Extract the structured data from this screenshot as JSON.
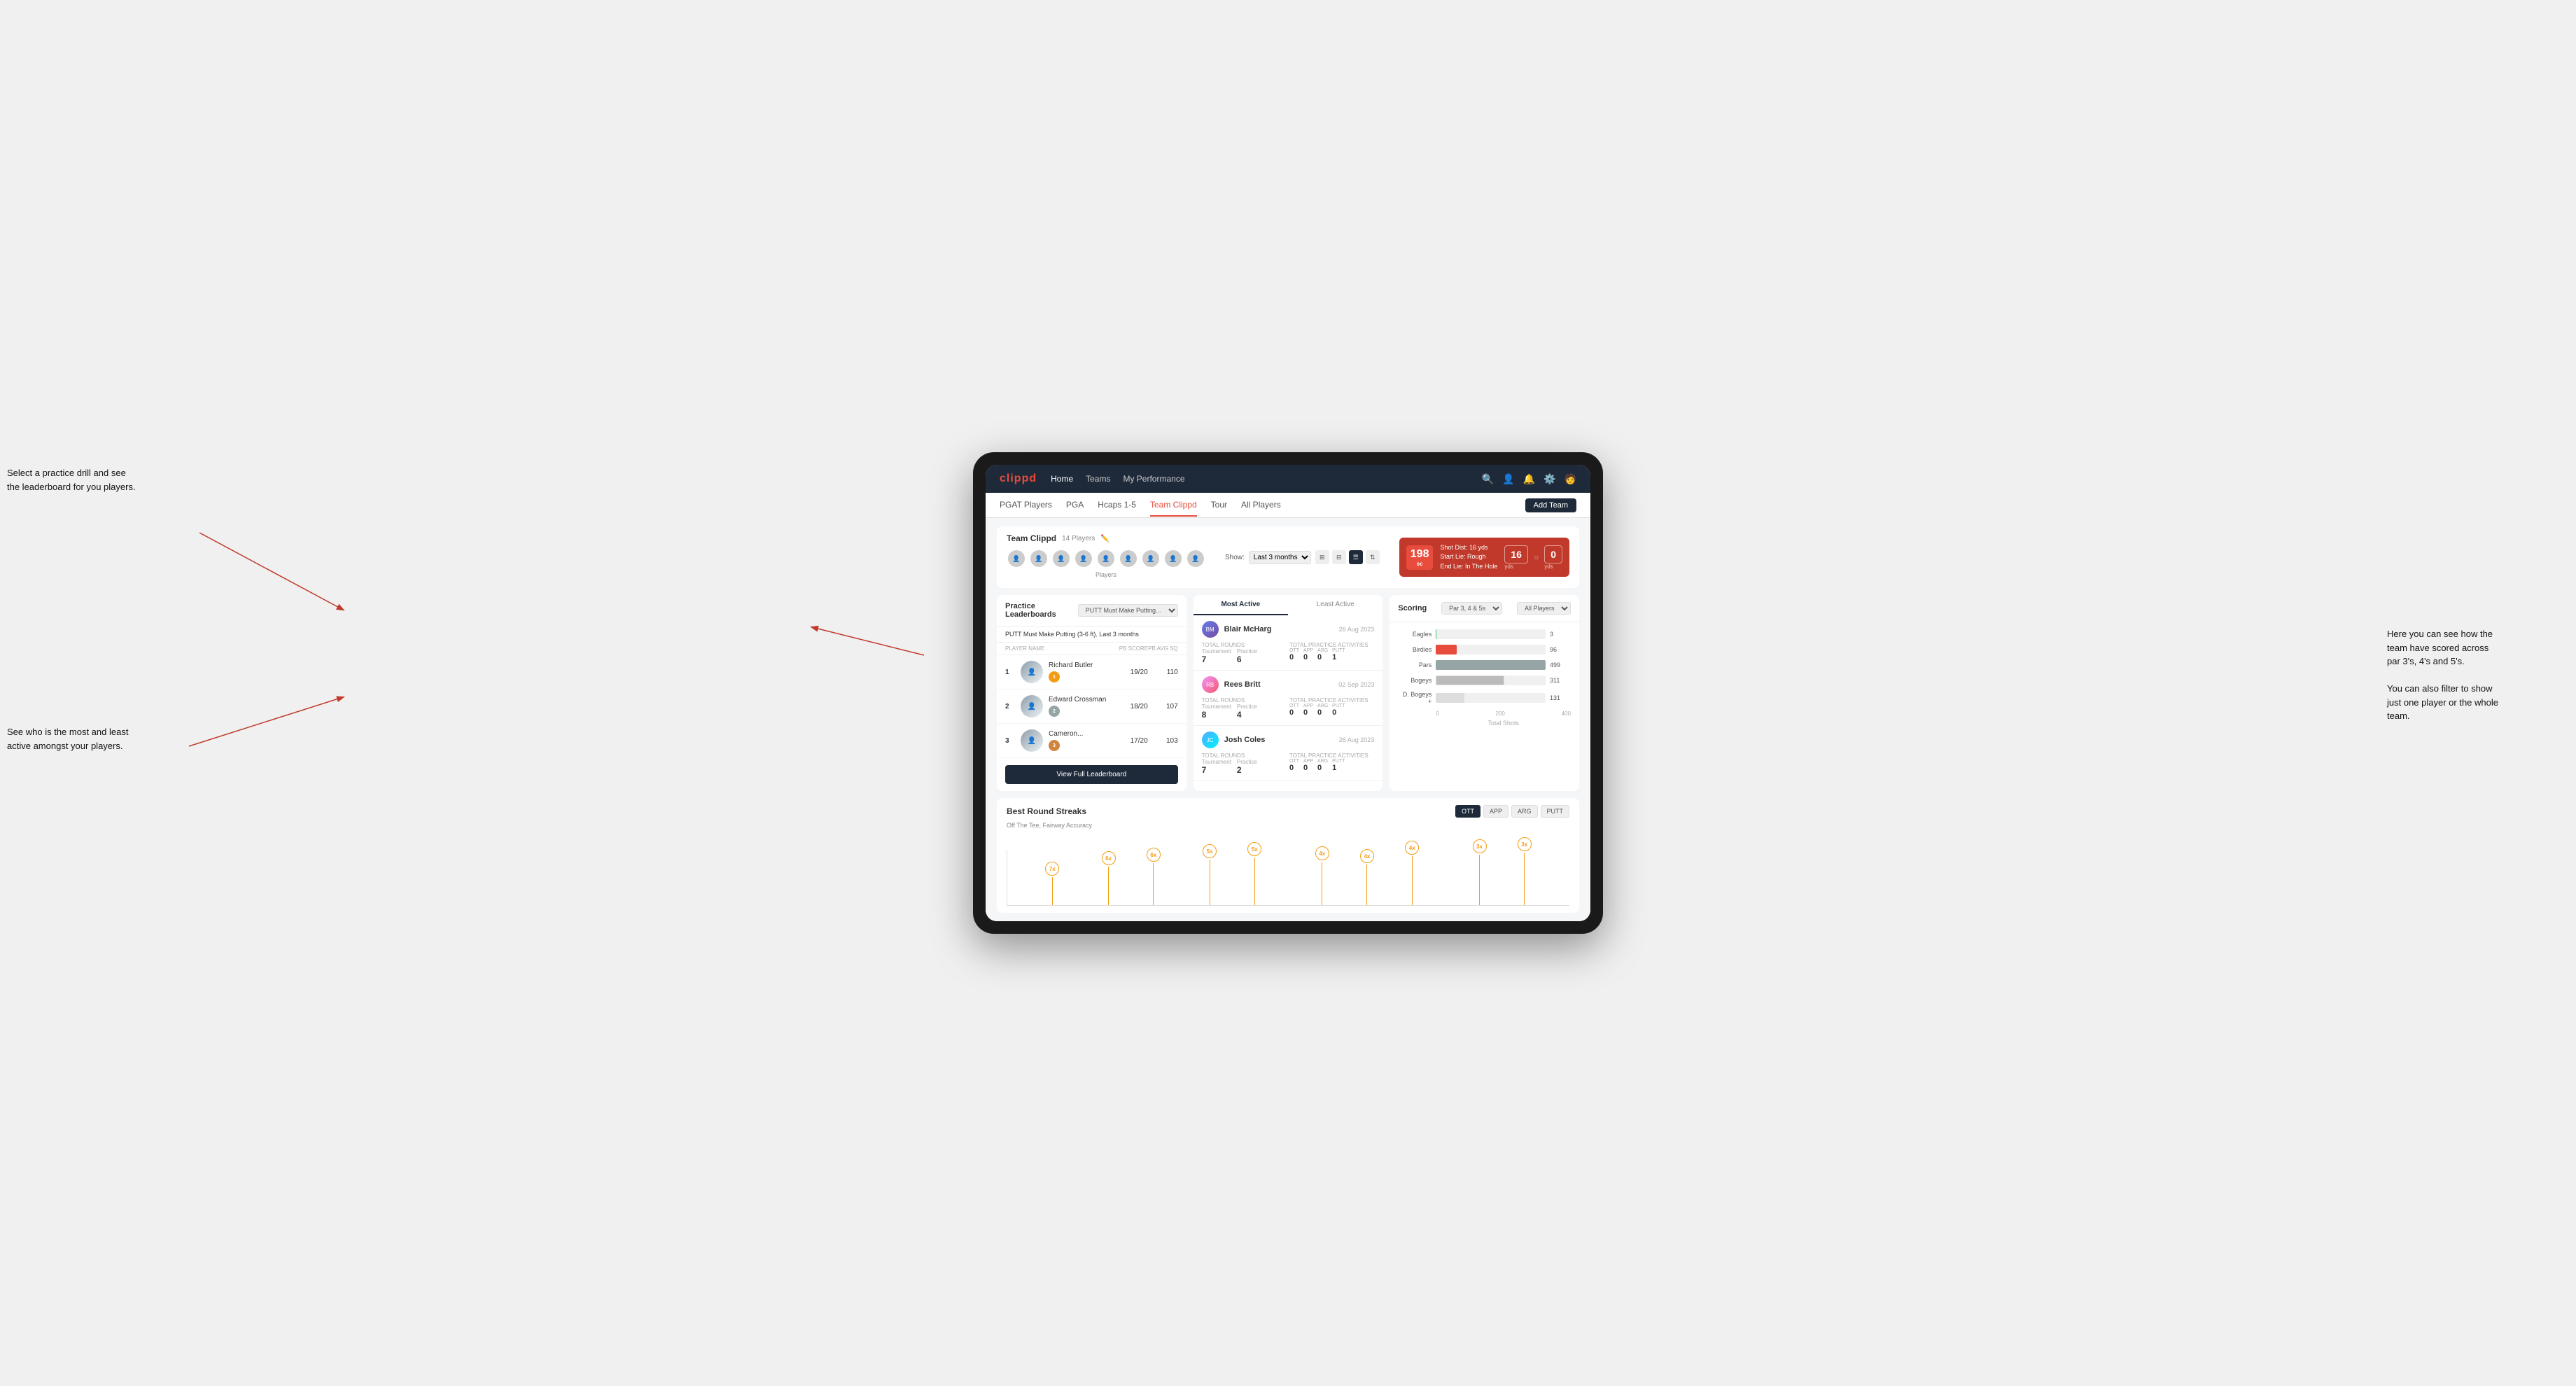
{
  "annotations": {
    "top_left": "Select a practice drill and see\nthe leaderboard for you players.",
    "bottom_left": "See who is the most and least\nactive amongst your players.",
    "right": "Here you can see how the\nteam have scored across\npar 3's, 4's and 5's.\n\nYou can also filter to show\njust one player or the whole\nteam."
  },
  "nav": {
    "logo": "clippd",
    "links": [
      "Home",
      "Teams",
      "My Performance"
    ],
    "icons": [
      "search",
      "user",
      "bell",
      "settings",
      "avatar"
    ]
  },
  "sub_nav": {
    "links": [
      "PGAT Players",
      "PGA",
      "Hcaps 1-5",
      "Team Clippd",
      "Tour",
      "All Players"
    ],
    "active": "Team Clippd",
    "add_team": "Add Team"
  },
  "team": {
    "title": "Team Clippd",
    "player_count": "14 Players",
    "show_label": "Show:",
    "show_value": "Last 3 months",
    "players_label": "Players"
  },
  "shot_card": {
    "dist": "198",
    "dist_unit": "sc",
    "shot_dist_label": "Shot Dist: 16 yds",
    "start_lie": "Start Lie: Rough",
    "end_lie": "End Lie: In The Hole",
    "yds_1": "16",
    "yds_1_label": "yds",
    "yds_2": "0",
    "yds_2_label": "yds"
  },
  "practice_leaderboard": {
    "title": "Practice Leaderboards",
    "drill": "PUTT Must Make Putting...",
    "subtitle_drill": "PUTT Must Make Putting (3-6 ft)",
    "subtitle_period": "Last 3 months",
    "col_player": "PLAYER NAME",
    "col_score": "PB SCORE",
    "col_avg": "PB AVG SQ",
    "players": [
      {
        "rank": "1",
        "name": "Richard Butler",
        "badge": "1",
        "badge_type": "gold",
        "score": "19/20",
        "avg": "110"
      },
      {
        "rank": "2",
        "name": "Edward Crossman",
        "badge": "2",
        "badge_type": "silver",
        "score": "18/20",
        "avg": "107"
      },
      {
        "rank": "3",
        "name": "Cameron...",
        "badge": "3",
        "badge_type": "bronze",
        "score": "17/20",
        "avg": "103"
      }
    ],
    "view_full": "View Full Leaderboard"
  },
  "activity": {
    "tabs": [
      "Most Active",
      "Least Active"
    ],
    "active_tab": "Most Active",
    "players": [
      {
        "name": "Blair McHarg",
        "date": "26 Aug 2023",
        "total_rounds_label": "Total Rounds",
        "tournament": "7",
        "practice": "6",
        "tournament_label": "Tournament",
        "practice_label": "Practice",
        "total_practice_label": "Total Practice Activities",
        "ott": "0",
        "app": "0",
        "arg": "0",
        "putt": "1"
      },
      {
        "name": "Rees Britt",
        "date": "02 Sep 2023",
        "total_rounds_label": "Total Rounds",
        "tournament": "8",
        "practice": "4",
        "tournament_label": "Tournament",
        "practice_label": "Practice",
        "total_practice_label": "Total Practice Activities",
        "ott": "0",
        "app": "0",
        "arg": "0",
        "putt": "0"
      },
      {
        "name": "Josh Coles",
        "date": "26 Aug 2023",
        "total_rounds_label": "Total Rounds",
        "tournament": "7",
        "practice": "2",
        "tournament_label": "Tournament",
        "practice_label": "Practice",
        "total_practice_label": "Total Practice Activities",
        "ott": "0",
        "app": "0",
        "arg": "0",
        "putt": "1"
      }
    ]
  },
  "scoring": {
    "title": "Scoring",
    "filter1": "Par 3, 4 & 5s",
    "filter2": "All Players",
    "bars": [
      {
        "label": "Eagles",
        "value": 3,
        "max": 500,
        "type": "eagles",
        "display": "3"
      },
      {
        "label": "Birdies",
        "value": 96,
        "max": 500,
        "type": "birdies",
        "display": "96"
      },
      {
        "label": "Pars",
        "value": 499,
        "max": 500,
        "type": "pars",
        "display": "499"
      },
      {
        "label": "Bogeys",
        "value": 311,
        "max": 500,
        "type": "bogeys",
        "display": "311"
      },
      {
        "label": "D. Bogeys +",
        "value": 131,
        "max": 500,
        "type": "dbogeys",
        "display": "131"
      }
    ],
    "x_axis": [
      "0",
      "200",
      "400"
    ],
    "x_label": "Total Shots"
  },
  "best_round_streaks": {
    "title": "Best Round Streaks",
    "subtitle": "Off The Tee, Fairway Accuracy",
    "tabs": [
      "OTT",
      "APP",
      "ARG",
      "PUTT"
    ],
    "active_tab": "OTT",
    "pins": [
      {
        "label": "7x",
        "left_pct": 8
      },
      {
        "label": "6x",
        "left_pct": 18
      },
      {
        "label": "6x",
        "left_pct": 26
      },
      {
        "label": "5x",
        "left_pct": 36
      },
      {
        "label": "5x",
        "left_pct": 44
      },
      {
        "label": "4x",
        "left_pct": 56
      },
      {
        "label": "4x",
        "left_pct": 64
      },
      {
        "label": "4x",
        "left_pct": 72
      },
      {
        "label": "3x",
        "left_pct": 84
      },
      {
        "label": "3x",
        "left_pct": 92
      }
    ]
  }
}
